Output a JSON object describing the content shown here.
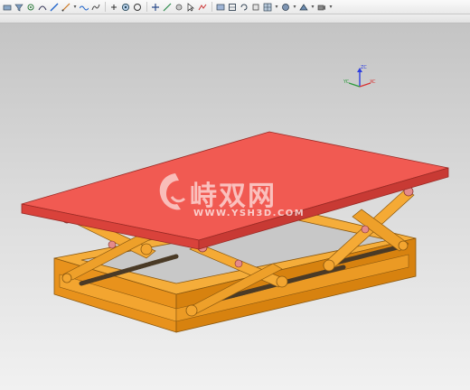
{
  "toolbar": {
    "icons": [
      "selection-icon",
      "filter-icon",
      "snap-point-icon",
      "curve-icon",
      "edge-icon",
      "measure-icon",
      "wave-icon",
      "spline-icon",
      "arrow-icon",
      "circle-target-icon",
      "hole-icon",
      "plus-icon",
      "line-icon",
      "region-icon",
      "pointer-icon",
      "view-icon",
      "display-icon",
      "rotate-icon",
      "orient-icon",
      "fit-icon",
      "layout-icon",
      "render-icon",
      "style-icon",
      "camera-icon"
    ],
    "dropdown_glyph": "▾"
  },
  "viewport": {
    "triad": {
      "z_label": "ZC",
      "y_label": "YC",
      "x_label": "XC"
    },
    "watermark": {
      "brand": "峙双网",
      "url": "WWW.YSH3D.COM"
    }
  },
  "colors": {
    "table_top": "#f15a52",
    "frame": "#f2a223",
    "rod": "#4a3a26",
    "bolt": "#e58a8a",
    "datum_plane": "#d99ec4",
    "triad_z": "#2f3fe0",
    "triad_x": "#d83030",
    "triad_y": "#2a9a3a"
  }
}
